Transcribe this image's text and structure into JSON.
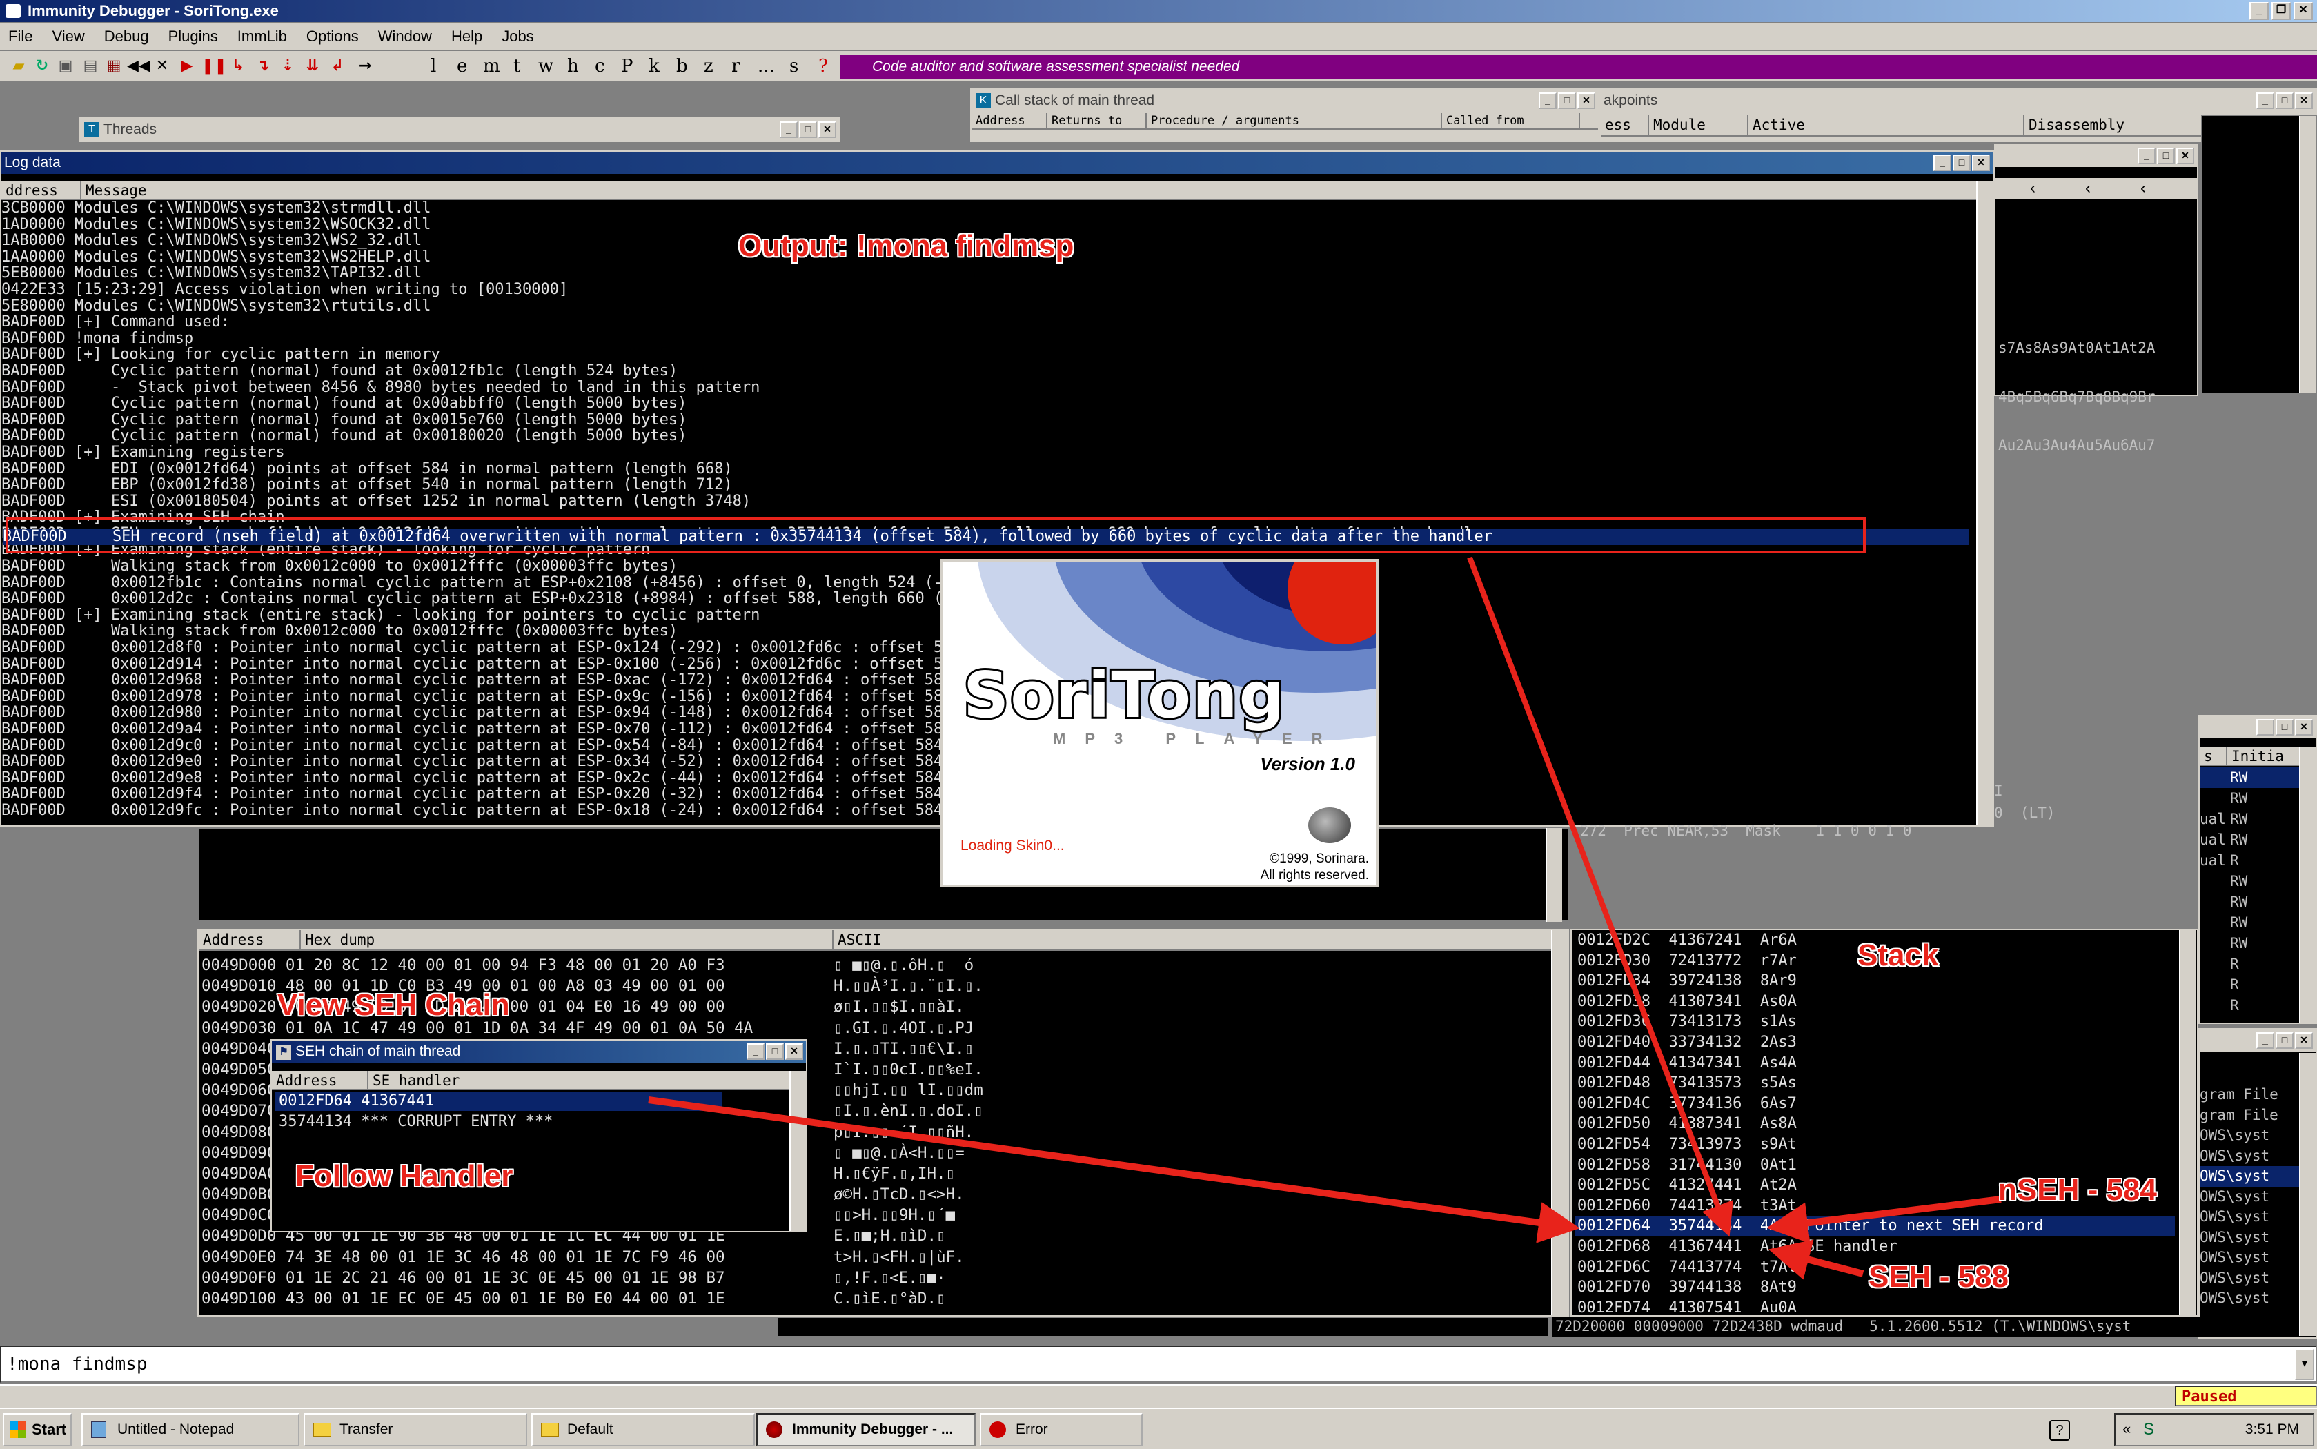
{
  "app": {
    "title": "Immunity Debugger - SoriTong.exe",
    "menu": [
      "File",
      "View",
      "Debug",
      "Plugins",
      "ImmLib",
      "Options",
      "Window",
      "Help",
      "Jobs"
    ],
    "toolbar_letters": [
      "l",
      "e",
      "m",
      "t",
      "w",
      "h",
      "c",
      "P",
      "k",
      "b",
      "z",
      "r",
      "...",
      "s",
      "?"
    ],
    "banner": "Code auditor and software assessment specialist needed"
  },
  "windows": {
    "threads_title": "Threads",
    "callstack_title": "Call stack of main thread",
    "callstack_headers": [
      "Address",
      "Returns to",
      "Procedure / arguments",
      "Called from"
    ],
    "breakpoints_title": "akpoints",
    "breakpoints_headers": [
      "ess",
      "Module",
      "Active",
      "Disassembly"
    ],
    "log_title": "Log data",
    "log_headers": [
      "ddress",
      "Message"
    ],
    "dump_headers": [
      "Address",
      "Hex dump",
      "ASCII"
    ],
    "seh_title": "SEH chain of main thread",
    "seh_headers": [
      "Address",
      "SE handler"
    ],
    "memory_header": [
      "s",
      "Initia"
    ]
  },
  "log_lines": [
    "3CB0000 Modules C:\\WINDOWS\\system32\\strmdll.dll",
    "1AD0000 Modules C:\\WINDOWS\\system32\\WSOCK32.dll",
    "1AB0000 Modules C:\\WINDOWS\\system32\\WS2_32.dll",
    "1AA0000 Modules C:\\WINDOWS\\system32\\WS2HELP.dll",
    "5EB0000 Modules C:\\WINDOWS\\system32\\TAPI32.dll",
    "0422E33 [15:23:29] Access violation when writing to [00130000]",
    "5E80000 Modules C:\\WINDOWS\\system32\\rtutils.dll",
    "BADF00D [+] Command used:",
    "BADF00D !mona findmsp",
    "BADF00D [+] Looking for cyclic pattern in memory",
    "BADF00D     Cyclic pattern (normal) found at 0x0012fb1c (length 524 bytes)",
    "BADF00D     -  Stack pivot between 8456 & 8980 bytes needed to land in this pattern",
    "BADF00D     Cyclic pattern (normal) found at 0x00abbff0 (length 5000 bytes)",
    "BADF00D     Cyclic pattern (normal) found at 0x0015e760 (length 5000 bytes)",
    "BADF00D     Cyclic pattern (normal) found at 0x00180020 (length 5000 bytes)",
    "BADF00D [+] Examining registers",
    "BADF00D     EDI (0x0012fd64) points at offset 584 in normal pattern (length 668)",
    "BADF00D     EBP (0x0012fd38) points at offset 540 in normal pattern (length 712)",
    "BADF00D     ESI (0x00180504) points at offset 1252 in normal pattern (length 3748)",
    "BADF00D [+] Examining SEH chain",
    "BADF00D     SEH record (nseh field) at 0x0012fd64 overwritten with normal pattern : 0x35744134 (offset 584), followed by 660 bytes of cyclic data after the handler",
    "BADF00D [+] Examining stack (entire stack) - looking for cyclic pattern",
    "BADF00D     Walking stack from 0x0012c000 to 0x0012fffc (0x00003ffc bytes)",
    "BADF00D     0x0012fb1c : Contains normal cyclic pattern at ESP+0x2108 (+8456) : offset 0, length 524 (-> 0x0012fd27 : ESP+0x2314)",
    "BADF00D     0x0012d2c : Contains normal cyclic pattern at ESP+0x2318 (+8984) : offset 588, length 660 (-> 0x0012ffbf : ESP+0x25ec)",
    "BADF00D [+] Examining stack (entire stack) - looking for pointers to cyclic pattern",
    "BADF00D     Walking stack from 0x0012c000 to 0x0012fffc (0x00003ffc bytes)",
    "BADF00D     0x0012d8f0 : Pointer into normal cyclic pattern at ESP-0x124 (-292) : 0x0012fd6c : offset 592",
    "BADF00D     0x0012d914 : Pointer into normal cyclic pattern at ESP-0x100 (-256) : 0x0012fd6c : offset 592",
    "BADF00D     0x0012d968 : Pointer into normal cyclic pattern at ESP-0xac (-172) : 0x0012fd64 : offset 584",
    "BADF00D     0x0012d978 : Pointer into normal cyclic pattern at ESP-0x9c (-156) : 0x0012fd64 : offset 584",
    "BADF00D     0x0012d980 : Pointer into normal cyclic pattern at ESP-0x94 (-148) : 0x0012fd64 : offset 584",
    "BADF00D     0x0012d9a4 : Pointer into normal cyclic pattern at ESP-0x70 (-112) : 0x0012fd64 : offset 584",
    "BADF00D     0x0012d9c0 : Pointer into normal cyclic pattern at ESP-0x54 (-84) : 0x0012fd64 : offset 584",
    "BADF00D     0x0012d9e0 : Pointer into normal cyclic pattern at ESP-0x34 (-52) : 0x0012fd64 : offset 584",
    "BADF00D     0x0012d9e8 : Pointer into normal cyclic pattern at ESP-0x2c (-44) : 0x0012fd64 : offset 584",
    "BADF00D     0x0012d9f4 : Pointer into normal cyclic pattern at ESP-0x20 (-32) : 0x0012fd64 : offset 584",
    "BADF00D     0x0012d9fc : Pointer into normal cyclic pattern at ESP-0x18 (-24) : 0x0012fd64 : offset 584"
  ],
  "right_pattern_lines": [
    "s7As8As9At0At1At2A",
    "4Bq5Bq6Bq7Bq8Bq9Br",
    "Au2Au3Au4Au5Au6Au7"
  ],
  "dump_lines": [
    "0049D000 01 20 8C 12 40 00 01 00 94 F3 48 00 01 20 A0 F3",
    "0049D010 48 00 01 1D C0 B3 49 00 01 00 A8 03 49 00 01 00",
    "0049D020 80 F3 49 00 01 1D 24 49 00 01 04 E0 16 49 00 00",
    "0049D030 01 0A 1C 47 49 00 01 1D 0A 34 4F 49 00 01 0A 50 4A",
    "0049D040",
    "0049D050",
    "0049D060",
    "0049D070",
    "0049D080",
    "0049D090",
    "0049D0A0",
    "0049D0B0",
    "0049D0C0",
    "0049D0D0 45 00 01 1E 90 3B 48 00 01 1E 1C EC 44 00 01 1E",
    "0049D0E0 74 3E 48 00 01 1E 3C 46 48 00 01 1E 7C F9 46 00",
    "0049D0F0 01 1E 2C 21 46 00 01 1E 3C 0E 45 00 01 1E 98 B7",
    "0049D100 43 00 01 1E EC 0E 45 00 01 1E B0 E0 44 00 01 1E"
  ],
  "ascii_lines": [
    "▯ ■▯@.▯.ôH.▯  ó",
    "H.▯▯À³I.▯.¨▯I.▯.",
    "ø▯I.▯▯$I.▯▯àI.",
    "▯.GI.▯.4OI.▯.PJ",
    "I.▯.▯TI.▯▯€\\I.▯",
    "I`I.▯▯0cI.▯▯%eI.",
    "▯▯hjI.▯▯ lI.▯▯dm",
    "▯I.▯.ènI.▯.doI.▯",
    "p▯I.▯▯ ´I.▯▯ñH.",
    "▯ ■▯@.▯À<H.▯▯=",
    "H.▯€ÿF.▯,IH.▯",
    "ø©H.▯TcD.▯<>H.",
    "▯▯>H.▯▯9H.▯´■",
    "E.▯■;H.▯ìD.▯",
    "t>H.▯<FH.▯|ùF.",
    "▯,!F.▯<E.▯■·",
    "C.▯ìE.▯°àD.▯"
  ],
  "seh_rows": [
    {
      "addr": "0012FD64",
      "handler": "41367441"
    },
    {
      "addr": "35744134",
      "handler": "*** CORRUPT ENTRY ***"
    }
  ],
  "stack_rows": [
    "0012FD2C  41367241  Ar6A",
    "0012FD30  72413772  r7Ar",
    "0012FD34  39724138  8Ar9",
    "0012FD38  41307341  As0A",
    "0012FD3C  73413173  s1As",
    "0012FD40  33734132  2As3",
    "0012FD44  41347341  As4A",
    "0012FD48  73413573  s5As",
    "0012FD4C  37734136  6As7",
    "0012FD50  41387341  As8A",
    "0012FD54  73413973  s9At",
    "0012FD58  31744130  0At1",
    "0012FD5C  41327441  At2A",
    "0012FD60  74413374  t3At",
    "0012FD64  35744134  4At5 Pointer to next SEH record",
    "0012FD68  41367441  At6A SE handler",
    "0012FD6C  74413774  t7At",
    "0012FD70  39744138  8At9",
    "0012FD74  41307541  Au0A"
  ],
  "memory_access": [
    "RW",
    "RW",
    "RW",
    "RW",
    "R",
    "RW",
    "RW",
    "RW",
    "RW",
    "R",
    "R",
    "R"
  ],
  "memory_prefix": [
    "",
    "",
    "ual",
    "ual",
    "ual",
    "",
    "",
    "",
    "",
    "",
    "",
    ""
  ],
  "right_panel_lines": [
    "gram File",
    "gram File",
    "OWS\\syst",
    "OWS\\syst",
    "OWS\\syst",
    "OWS\\syst",
    "OWS\\syst",
    "OWS\\syst",
    "OWS\\syst",
    "OWS\\syst",
    "OWS\\syst"
  ],
  "regs_fragment": "272  Prec NEAR,53  Mask    1 1 0 0 1 0",
  "regs_lt": "0  (LT)",
  "regs_i": "I",
  "modules_fragment": "72D20000 00009000 72D2438D wdmaud   5.1.2600.5512 (T.\\WINDOWS\\syst",
  "splash": {
    "logo": "SoriTong",
    "subtitle": "MP3 PLAYER",
    "version": "Version 1.0",
    "loading": "Loading Skin0...",
    "copyright": "©1999, Sorinara.",
    "rights": "All rights reserved."
  },
  "annotations": {
    "output": "Output: !mona findmsp",
    "view_seh": "View SEH Chain",
    "follow": "Follow Handler",
    "stack": "Stack",
    "nseh": "nSEH - 584",
    "seh": "SEH - 588"
  },
  "command": "!mona findmsp",
  "status": "Paused",
  "taskbar": {
    "start": "Start",
    "tasks": [
      "Untitled - Notepad",
      "Transfer",
      "Default",
      "Immunity Debugger - ...",
      "Error"
    ],
    "clock": "3:51 PM"
  },
  "colors": {
    "highlight": "#0a246a",
    "annot": "#e8231b",
    "banner": "#800080",
    "paused": "#c00000"
  }
}
